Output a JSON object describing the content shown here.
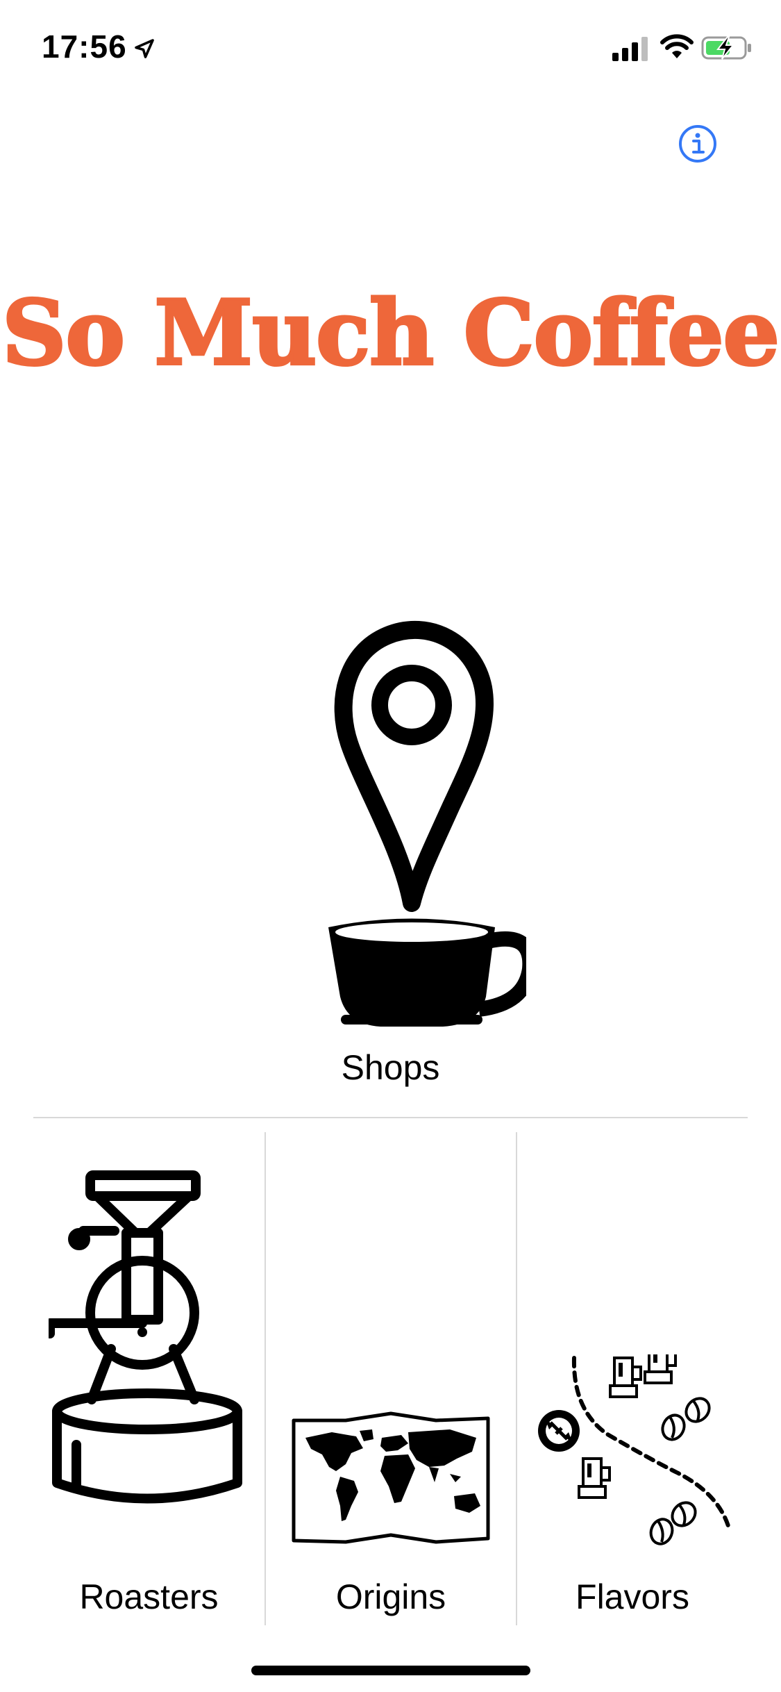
{
  "status_bar": {
    "time": "17:56",
    "icons": [
      "location-arrow-icon",
      "cellular-signal-icon",
      "wifi-icon",
      "battery-charging-icon"
    ]
  },
  "header": {
    "info_icon": "info-icon",
    "info_color": "#3478F6"
  },
  "app": {
    "title": "So Much Coffee",
    "title_color": "#EE673A"
  },
  "tiles": {
    "shops": {
      "label": "Shops",
      "icon": "map-pin-coffee-cup-icon"
    },
    "roasters": {
      "label": "Roasters",
      "icon": "coffee-roaster-icon"
    },
    "origins": {
      "label": "Origins",
      "icon": "world-map-icon"
    },
    "flavors": {
      "label": "Flavors",
      "icon": "flavor-journey-icon"
    }
  }
}
